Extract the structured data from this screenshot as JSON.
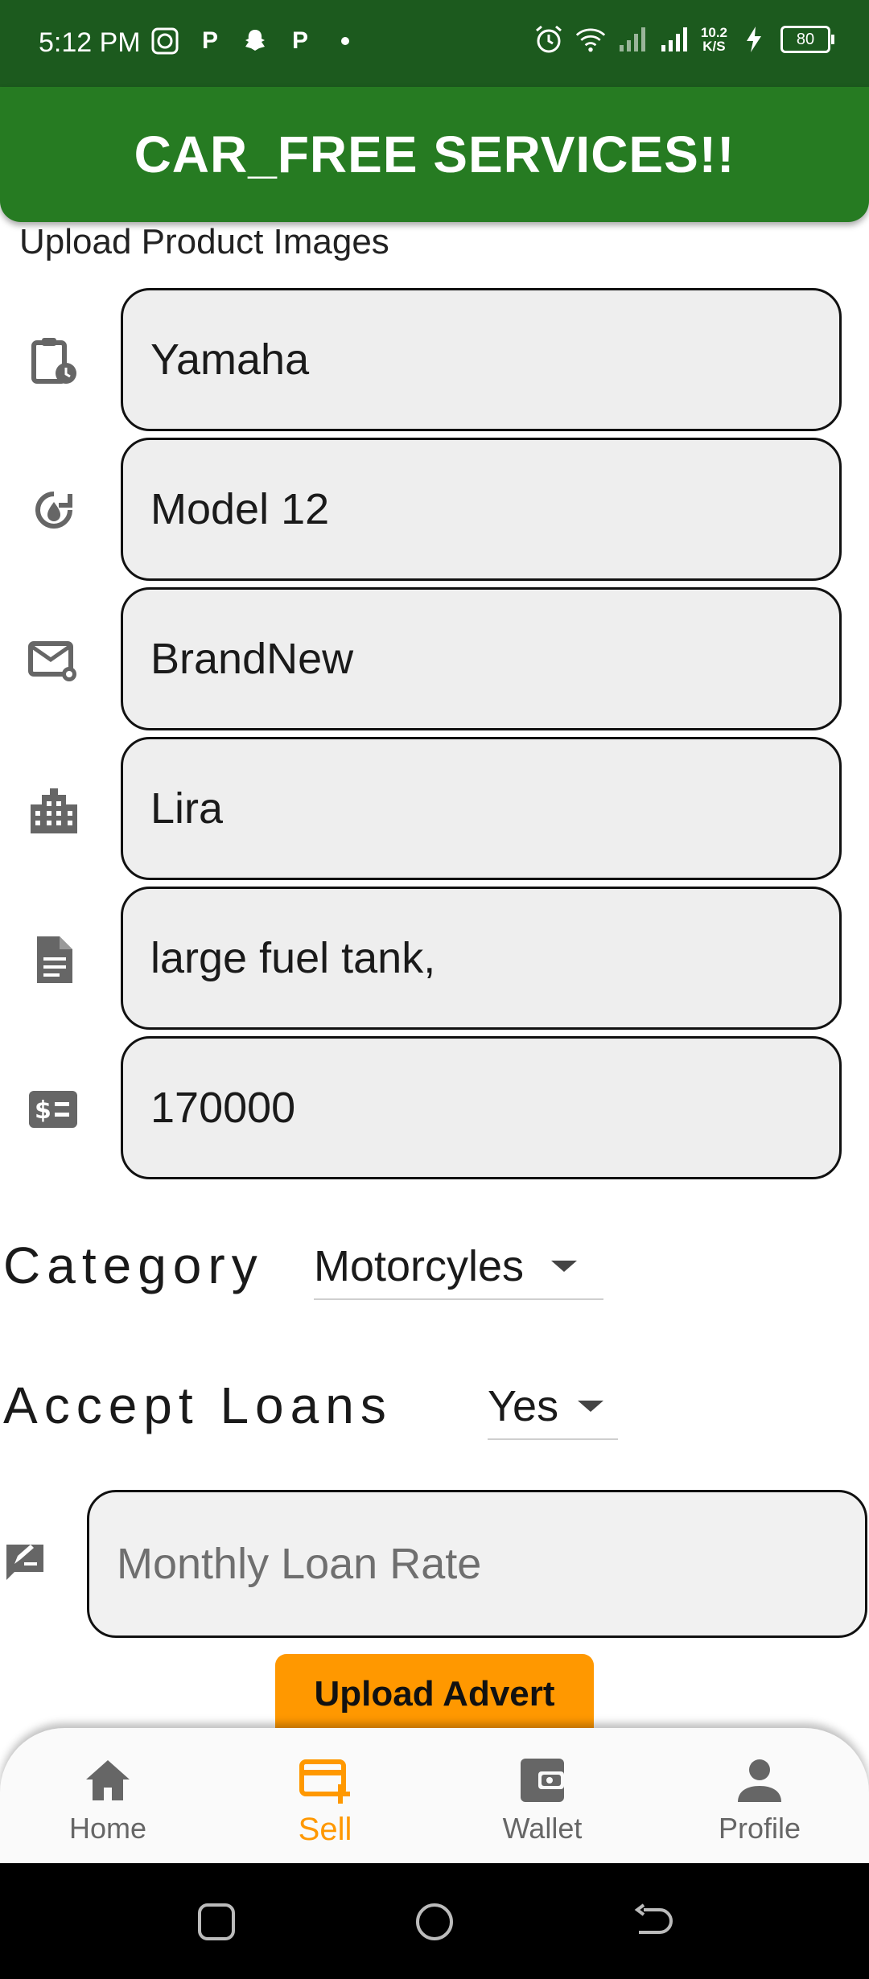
{
  "status_bar": {
    "time": "5:12 PM",
    "net_speed_value": "10.2",
    "net_speed_unit": "K/S",
    "battery": "80",
    "left_icons": [
      "whatsapp-icon",
      "p-icon",
      "snapchat-icon",
      "p-icon",
      "dot-icon"
    ],
    "right_icons": [
      "alarm-icon",
      "wifi-icon",
      "signal-icon",
      "signal-icon",
      "charging-icon",
      "battery-icon"
    ]
  },
  "app_bar": {
    "title": "CAR_FREE SERVICES!!"
  },
  "upload_images_label": "Upload Product Images",
  "fields": [
    {
      "icon": "clipboard-clock-icon",
      "value": "Yamaha"
    },
    {
      "icon": "ambient-lift-icon",
      "value": "Model 12"
    },
    {
      "icon": "mail-lock-icon",
      "value": "BrandNew"
    },
    {
      "icon": "city-icon",
      "value": "Lira"
    },
    {
      "icon": "document-icon",
      "value": "large fuel tank,"
    },
    {
      "icon": "price-tag-icon",
      "value": "170000"
    }
  ],
  "category": {
    "label": "Category",
    "selected": "Motorcyles"
  },
  "accept_loans": {
    "label": "Accept Loans",
    "selected": "Yes"
  },
  "monthly_loan_rate": {
    "icon": "rate-review-icon",
    "placeholder": "Monthly Loan Rate",
    "value": ""
  },
  "upload_button": "Upload Advert",
  "bottom_nav": {
    "items": [
      {
        "label": "Home",
        "icon": "home-icon",
        "active": false
      },
      {
        "label": "Sell",
        "icon": "add-card-icon",
        "active": true
      },
      {
        "label": "Wallet",
        "icon": "wallet-icon",
        "active": false
      },
      {
        "label": "Profile",
        "icon": "profile-icon",
        "active": false
      }
    ]
  },
  "colors": {
    "status_bar": "#1c5a1e",
    "app_bar": "#267b22",
    "accent": "#ff9800",
    "field_bg": "#eeeeee"
  }
}
